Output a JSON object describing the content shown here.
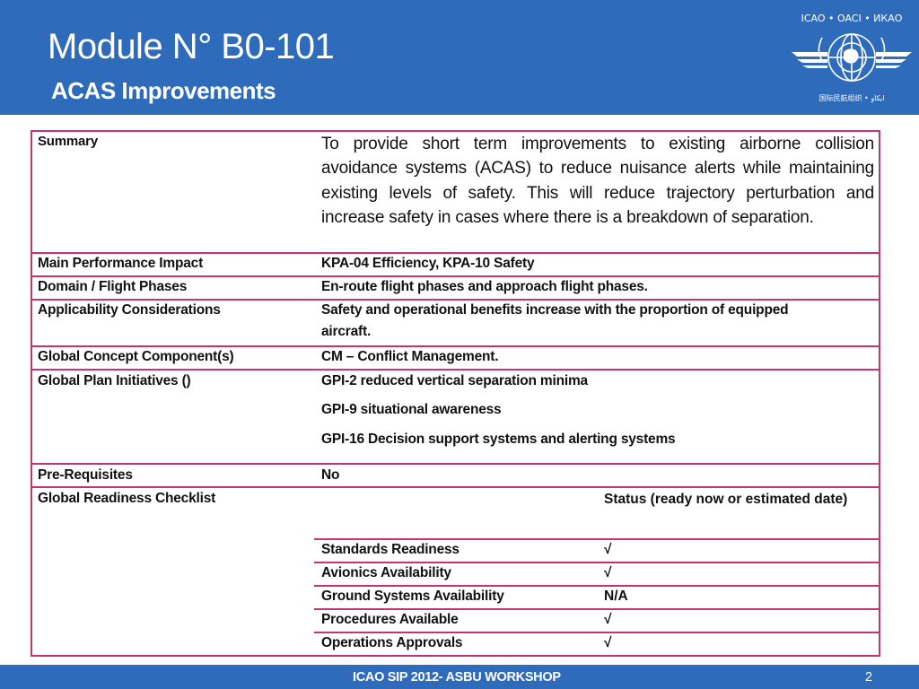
{
  "header": {
    "title": "Module N° B0-101",
    "subtitle": "ACAS Improvements",
    "logo": "icao-emblem-icon",
    "logo_ring_text": "ICAO • OACI • ИКАО"
  },
  "table": {
    "rows": [
      {
        "label": "Summary",
        "value": "To provide short term improvements to existing airborne collision avoidance systems (ACAS) to reduce nuisance alerts while maintaining existing levels of safety. This will reduce trajectory perturbation and increase safety in cases where there is a breakdown of separation."
      },
      {
        "label": "Main Performance Impact",
        "value": "KPA-04 Efficiency, KPA-10 Safety"
      },
      {
        "label": "Domain / Flight Phases",
        "value": "En-route flight phases and approach flight phases."
      },
      {
        "label": "Applicability Considerations",
        "value_line1": "Safety and operational benefits increase with the proportion of equipped",
        "value_line2": "aircraft."
      },
      {
        "label": "Global Concept Component(s)",
        "value": "CM – Conflict Management."
      },
      {
        "label": "Global Plan Initiatives ()",
        "values": [
          "GPI-2 reduced vertical separation minima",
          "GPI-9 situational awareness",
          "GPI-16 Decision support systems and alerting systems"
        ]
      },
      {
        "label": "Pre-Requisites",
        "value": "No"
      },
      {
        "label": "Global Readiness Checklist",
        "status_header": "Status (ready now or estimated date)"
      }
    ],
    "checklist": [
      {
        "item": "Standards Readiness",
        "status": "√"
      },
      {
        "item": "Avionics Availability",
        "status": "√"
      },
      {
        "item": "Ground Systems Availability",
        "status": "N/A"
      },
      {
        "item": "Procedures Available",
        "status": "√"
      },
      {
        "item": "Operations Approvals",
        "status": "√"
      }
    ]
  },
  "footer": {
    "text": "ICAO SIP 2012- ASBU WORKSHOP",
    "page": "2"
  },
  "colors": {
    "header_blue": "#2f6bbb",
    "border_magenta": "#c8336d"
  }
}
